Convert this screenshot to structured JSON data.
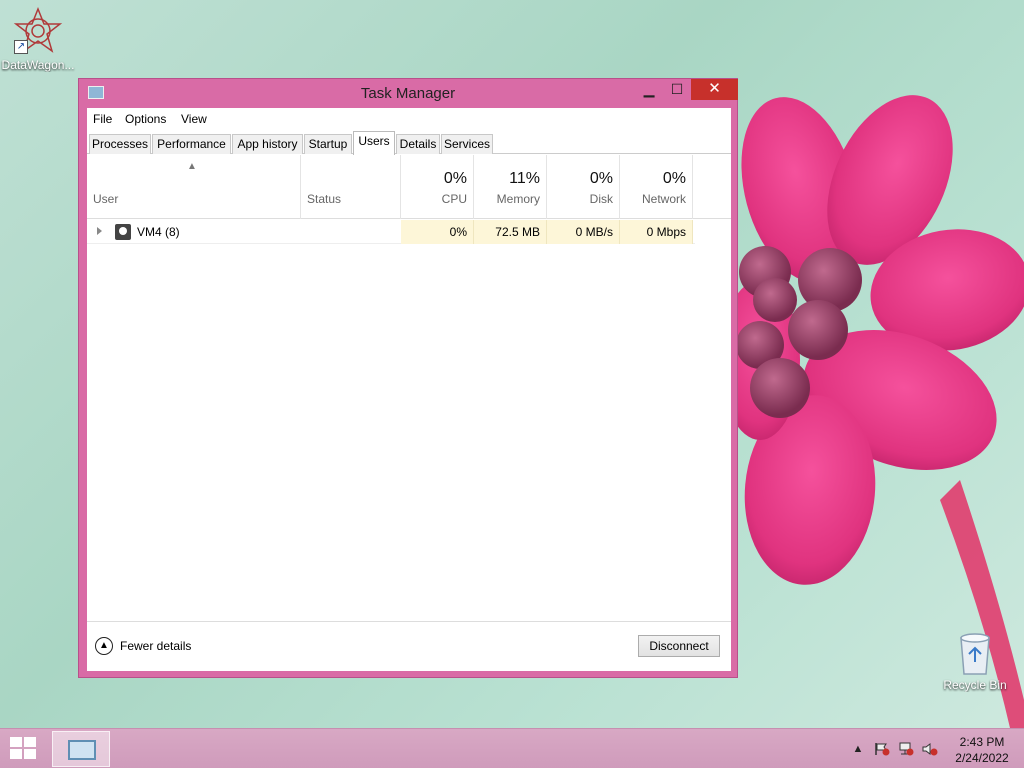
{
  "desktop": {
    "icons": [
      {
        "label": "DataWagon..."
      },
      {
        "label": "Recycle Bin"
      }
    ]
  },
  "window": {
    "title": "Task Manager",
    "controls": {
      "minimize": "▁",
      "maximize": "☐",
      "close": "✕"
    },
    "menu": [
      "File",
      "Options",
      "View"
    ],
    "tabs": [
      "Processes",
      "Performance",
      "App history",
      "Startup",
      "Users",
      "Details",
      "Services"
    ],
    "active_tab": "Users",
    "columns": {
      "user": "User",
      "status": "Status",
      "cpu": {
        "pct": "0%",
        "name": "CPU"
      },
      "memory": {
        "pct": "11%",
        "name": "Memory"
      },
      "disk": {
        "pct": "0%",
        "name": "Disk"
      },
      "network": {
        "pct": "0%",
        "name": "Network"
      }
    },
    "rows": [
      {
        "user": "VM4 (8)",
        "status": "",
        "cpu": "0%",
        "memory": "72.5 MB",
        "disk": "0 MB/s",
        "network": "0 Mbps"
      }
    ],
    "footer": {
      "fewer_details": "Fewer details",
      "disconnect": "Disconnect"
    }
  },
  "taskbar": {
    "clock": {
      "time": "2:43 PM",
      "date": "2/24/2022"
    },
    "tray_chevron": "▲"
  },
  "colors": {
    "window_frame": "#d96ba6",
    "close_button": "#c7302b",
    "taskbar": "#d8a8c4",
    "metric_cell": "#fdf6d8"
  }
}
